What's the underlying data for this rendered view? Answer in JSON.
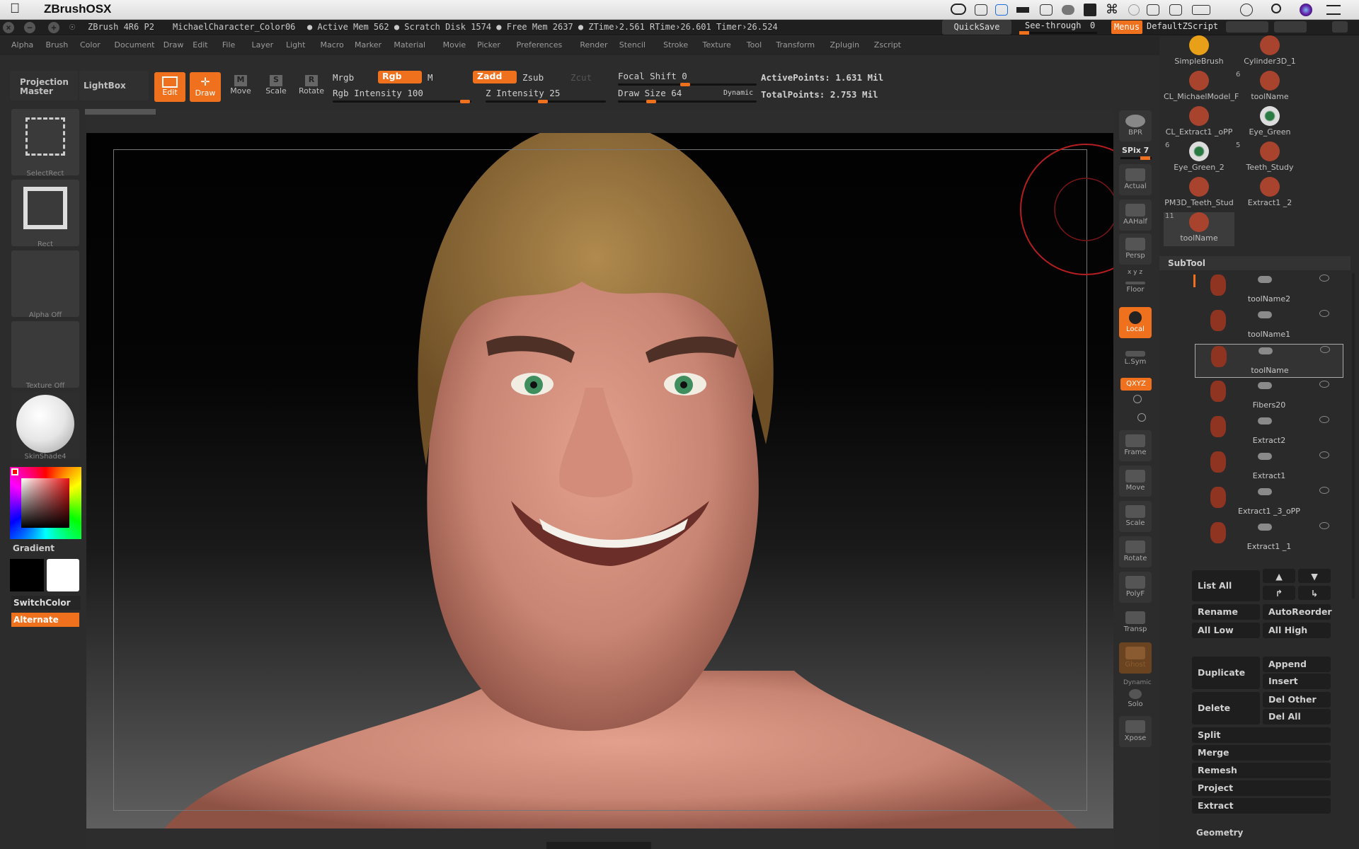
{
  "mac": {
    "app_name": "ZBrushOSX",
    "apple_icon": "apple-logo-icon",
    "status_icons": [
      "creative-cloud-icon",
      "checkbox-icon",
      "dropbox-icon",
      "battery-status-icon",
      "window-icon",
      "cloud-icon",
      "calendar-icon",
      "wifi-icon",
      "user-icon",
      "airplay-icon",
      "display-icon",
      "battery-icon",
      "clock-icon",
      "search-icon",
      "siri-icon",
      "menu-list-icon"
    ]
  },
  "titlebar": {
    "title": "ZBrush 4R6 P2",
    "document": "MichaelCharacter_Color06",
    "stats": "● Active Mem 562 ● Scratch Disk 1574 ● Free Mem 2637 ● ZTime›2.561 RTime›26.601 Timer›26.524",
    "quicksave": "QuickSave",
    "see_through_label": "See-through",
    "see_through_value": "0",
    "menus": "Menus",
    "default_script": "DefaultZScript"
  },
  "menu": [
    "Alpha",
    "Brush",
    "Color",
    "Document",
    "Draw",
    "Edit",
    "File",
    "Layer",
    "Light",
    "Macro",
    "Marker",
    "Material",
    "Movie",
    "Picker",
    "Preferences",
    "Render",
    "Stencil",
    "Stroke",
    "Texture",
    "Tool",
    "Transform",
    "Zplugin",
    "Zscript"
  ],
  "shelf": {
    "projection_master": "Projection Master",
    "lightbox": "LightBox",
    "edit": "Edit",
    "draw": "Draw",
    "move": "Move",
    "scale": "Scale",
    "rotate": "Rotate",
    "mrgb": "Mrgb",
    "rgb": "Rgb",
    "m": "M",
    "zadd": "Zadd",
    "zsub": "Zsub",
    "zcut": "Zcut",
    "rgb_intensity": "Rgb Intensity 100",
    "z_intensity": "Z Intensity 25",
    "focal_shift": "Focal Shift 0",
    "draw_size": "Draw Size 64",
    "dynamic": "Dynamic",
    "active_points": "ActivePoints: 1.631  Mil",
    "total_points": "TotalPoints: 2.753  Mil"
  },
  "left": {
    "select_rect": "SelectRect",
    "rect": "Rect",
    "alpha_off": "Alpha  Off",
    "texture_off": "Texture  Off",
    "material": "SkinShade4",
    "gradient": "Gradient",
    "switch_color": "SwitchColor",
    "alternate": "Alternate"
  },
  "right_tools": {
    "bpr": "BPR",
    "spix": "SPix 7",
    "actual": "Actual",
    "aahalf": "AAHalf",
    "persp": "Persp",
    "xyz_small": "x y z",
    "floor": "Floor",
    "local": "Local",
    "lsym": "L.Sym",
    "qxyz": "QXYZ",
    "frame": "Frame",
    "move": "Move",
    "scale": "Scale",
    "rotate": "Rotate",
    "polyf": "PolyF",
    "transp": "Transp",
    "ghost": "Ghost",
    "dynamic": "Dynamic",
    "solo": "Solo",
    "xpose": "Xpose"
  },
  "tools": [
    {
      "name": "SimpleBrush",
      "num": ""
    },
    {
      "name": "Cylinder3D_1",
      "num": ""
    },
    {
      "name": "CL_MichaelModel_F",
      "num": ""
    },
    {
      "name": "toolName",
      "num": "6"
    },
    {
      "name": "CL_Extract1 _oPP",
      "num": ""
    },
    {
      "name": "Eye_Green",
      "num": ""
    },
    {
      "name": "Eye_Green_2",
      "num": "6"
    },
    {
      "name": "Teeth_Study",
      "num": "5"
    },
    {
      "name": "PM3D_Teeth_Stud",
      "num": ""
    },
    {
      "name": "Extract1 _2",
      "num": ""
    },
    {
      "name": "toolName",
      "num": "11"
    }
  ],
  "subtool": {
    "header": "SubTool",
    "items": [
      "toolName2",
      "toolName1",
      "toolName",
      "Fibers20",
      "Extract2",
      "Extract1",
      "Extract1 _3_oPP",
      "Extract1 _1"
    ],
    "list_all": "List  All",
    "rename": "Rename",
    "autoreorder": "AutoReorder",
    "all_low": "All  Low",
    "all_high": "All  High",
    "duplicate": "Duplicate",
    "append": "Append",
    "insert": "Insert",
    "delete": "Delete",
    "del_other": "Del  Other",
    "del_all": "Del  All",
    "split": "Split",
    "merge": "Merge",
    "remesh": "Remesh",
    "project": "Project",
    "extract": "Extract",
    "geometry": "Geometry"
  },
  "colors": {
    "accent": "#f0711d",
    "panel": "#2c2c2c",
    "canvas_top": "#020202"
  }
}
